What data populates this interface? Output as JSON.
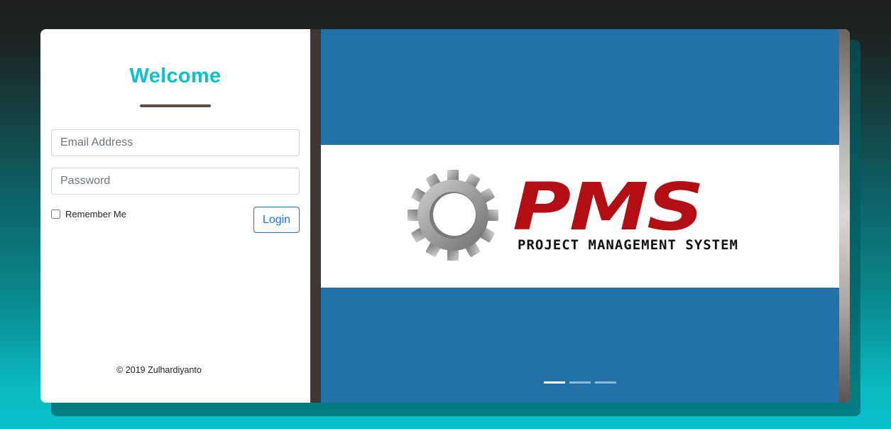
{
  "login": {
    "title": "Welcome",
    "email_placeholder": "Email Address",
    "password_placeholder": "Password",
    "remember_label": "Remember Me",
    "login_label": "Login",
    "footer": "© 2019 Zulhardiyanto"
  },
  "carousel": {
    "slide": {
      "logo_text": "PMS",
      "logo_subtitle": "PROJECT MANAGEMENT SYSTEM",
      "logo_icon": "gear-icon"
    },
    "indicator_count": 3,
    "active_index": 0
  },
  "colors": {
    "accent": "#0fc0cc",
    "brand_red": "#b30f12",
    "slide_bg": "#2072a9",
    "button_blue": "#1a73d9"
  }
}
